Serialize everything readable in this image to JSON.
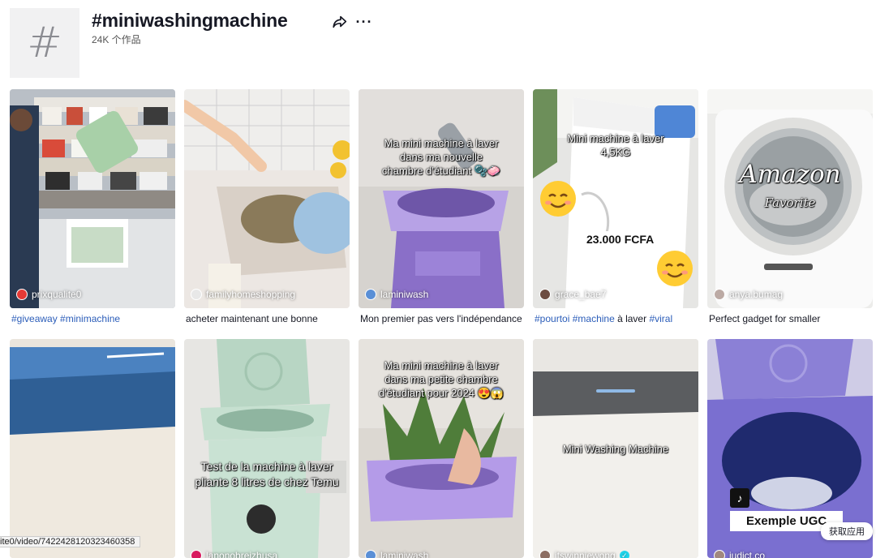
{
  "header": {
    "hash_symbol": "#",
    "title": "#miniwashingmachine",
    "count": "24K 个作品",
    "share_icon": "share-arrow-icon",
    "more_icon": "more-dots-icon",
    "more_label": "···"
  },
  "row1": [
    {
      "author": "prixqualite0",
      "caption": [
        {
          "text": "#giveaway",
          "tag": true
        },
        {
          "text": " ",
          "tag": false
        },
        {
          "text": "#minimachine",
          "tag": true
        }
      ],
      "avatar_color": "#e53935"
    },
    {
      "author": "familyhomeshopping",
      "caption": [
        {
          "text": "acheter maintenant une bonne",
          "tag": false
        }
      ],
      "avatar_color": "#e8e8e8"
    },
    {
      "author": "laminiwash",
      "overlay": "Ma mini machine à laver dans ma nouvelle chambre d'étudiant 🫧🧼",
      "caption": [
        {
          "text": "Mon premier pas vers l'indépendance",
          "tag": false
        }
      ],
      "avatar_color": "#5a8fd6"
    },
    {
      "author": "grace_bae7",
      "overlay": "Mini machine à laver 4,5KG",
      "price": "23.000 FCFA",
      "caption": [
        {
          "text": "#pourtoi",
          "tag": true
        },
        {
          "text": " ",
          "tag": false
        },
        {
          "text": "#machine",
          "tag": true
        },
        {
          "text": " à laver ",
          "tag": false
        },
        {
          "text": "#viral",
          "tag": true
        }
      ],
      "avatar_color": "#6d4c41"
    },
    {
      "author": "anya.bumag",
      "overlay_title": "Amazon",
      "overlay_sub": "Favorite",
      "caption": [
        {
          "text": "Perfect gadget for smaller",
          "tag": false
        }
      ],
      "avatar_color": "#bcaaa4"
    }
  ],
  "row2": [
    {
      "author": "",
      "avatar_color": "#ffffff"
    },
    {
      "author": "lanonobreizhusa",
      "overlay": "Test de la machine à laver pliante 8 litres de chez Temu",
      "avatar_color": "#d81b60"
    },
    {
      "author": "laminiwash",
      "overlay": "Ma mini machine à laver dans ma petite chambre d'étudiant pour 2024 😍😱",
      "avatar_color": "#5a8fd6"
    },
    {
      "author": "itswinniewong",
      "overlay": "Mini Washing Machine",
      "verified": "✓",
      "avatar_color": "#8d6e63"
    },
    {
      "author": "judict.co",
      "ugc": "Exemple UGC",
      "tiktok_icon": "tiktok-icon",
      "tiktok_glyph": "♪",
      "avatar_color": "#a1887f"
    }
  ],
  "status_url": "ite0/video/7422428120323460358",
  "get_app": "获取应用",
  "colors": {
    "tag": "#2b5db9",
    "text": "#161823",
    "muted": "#555555"
  }
}
